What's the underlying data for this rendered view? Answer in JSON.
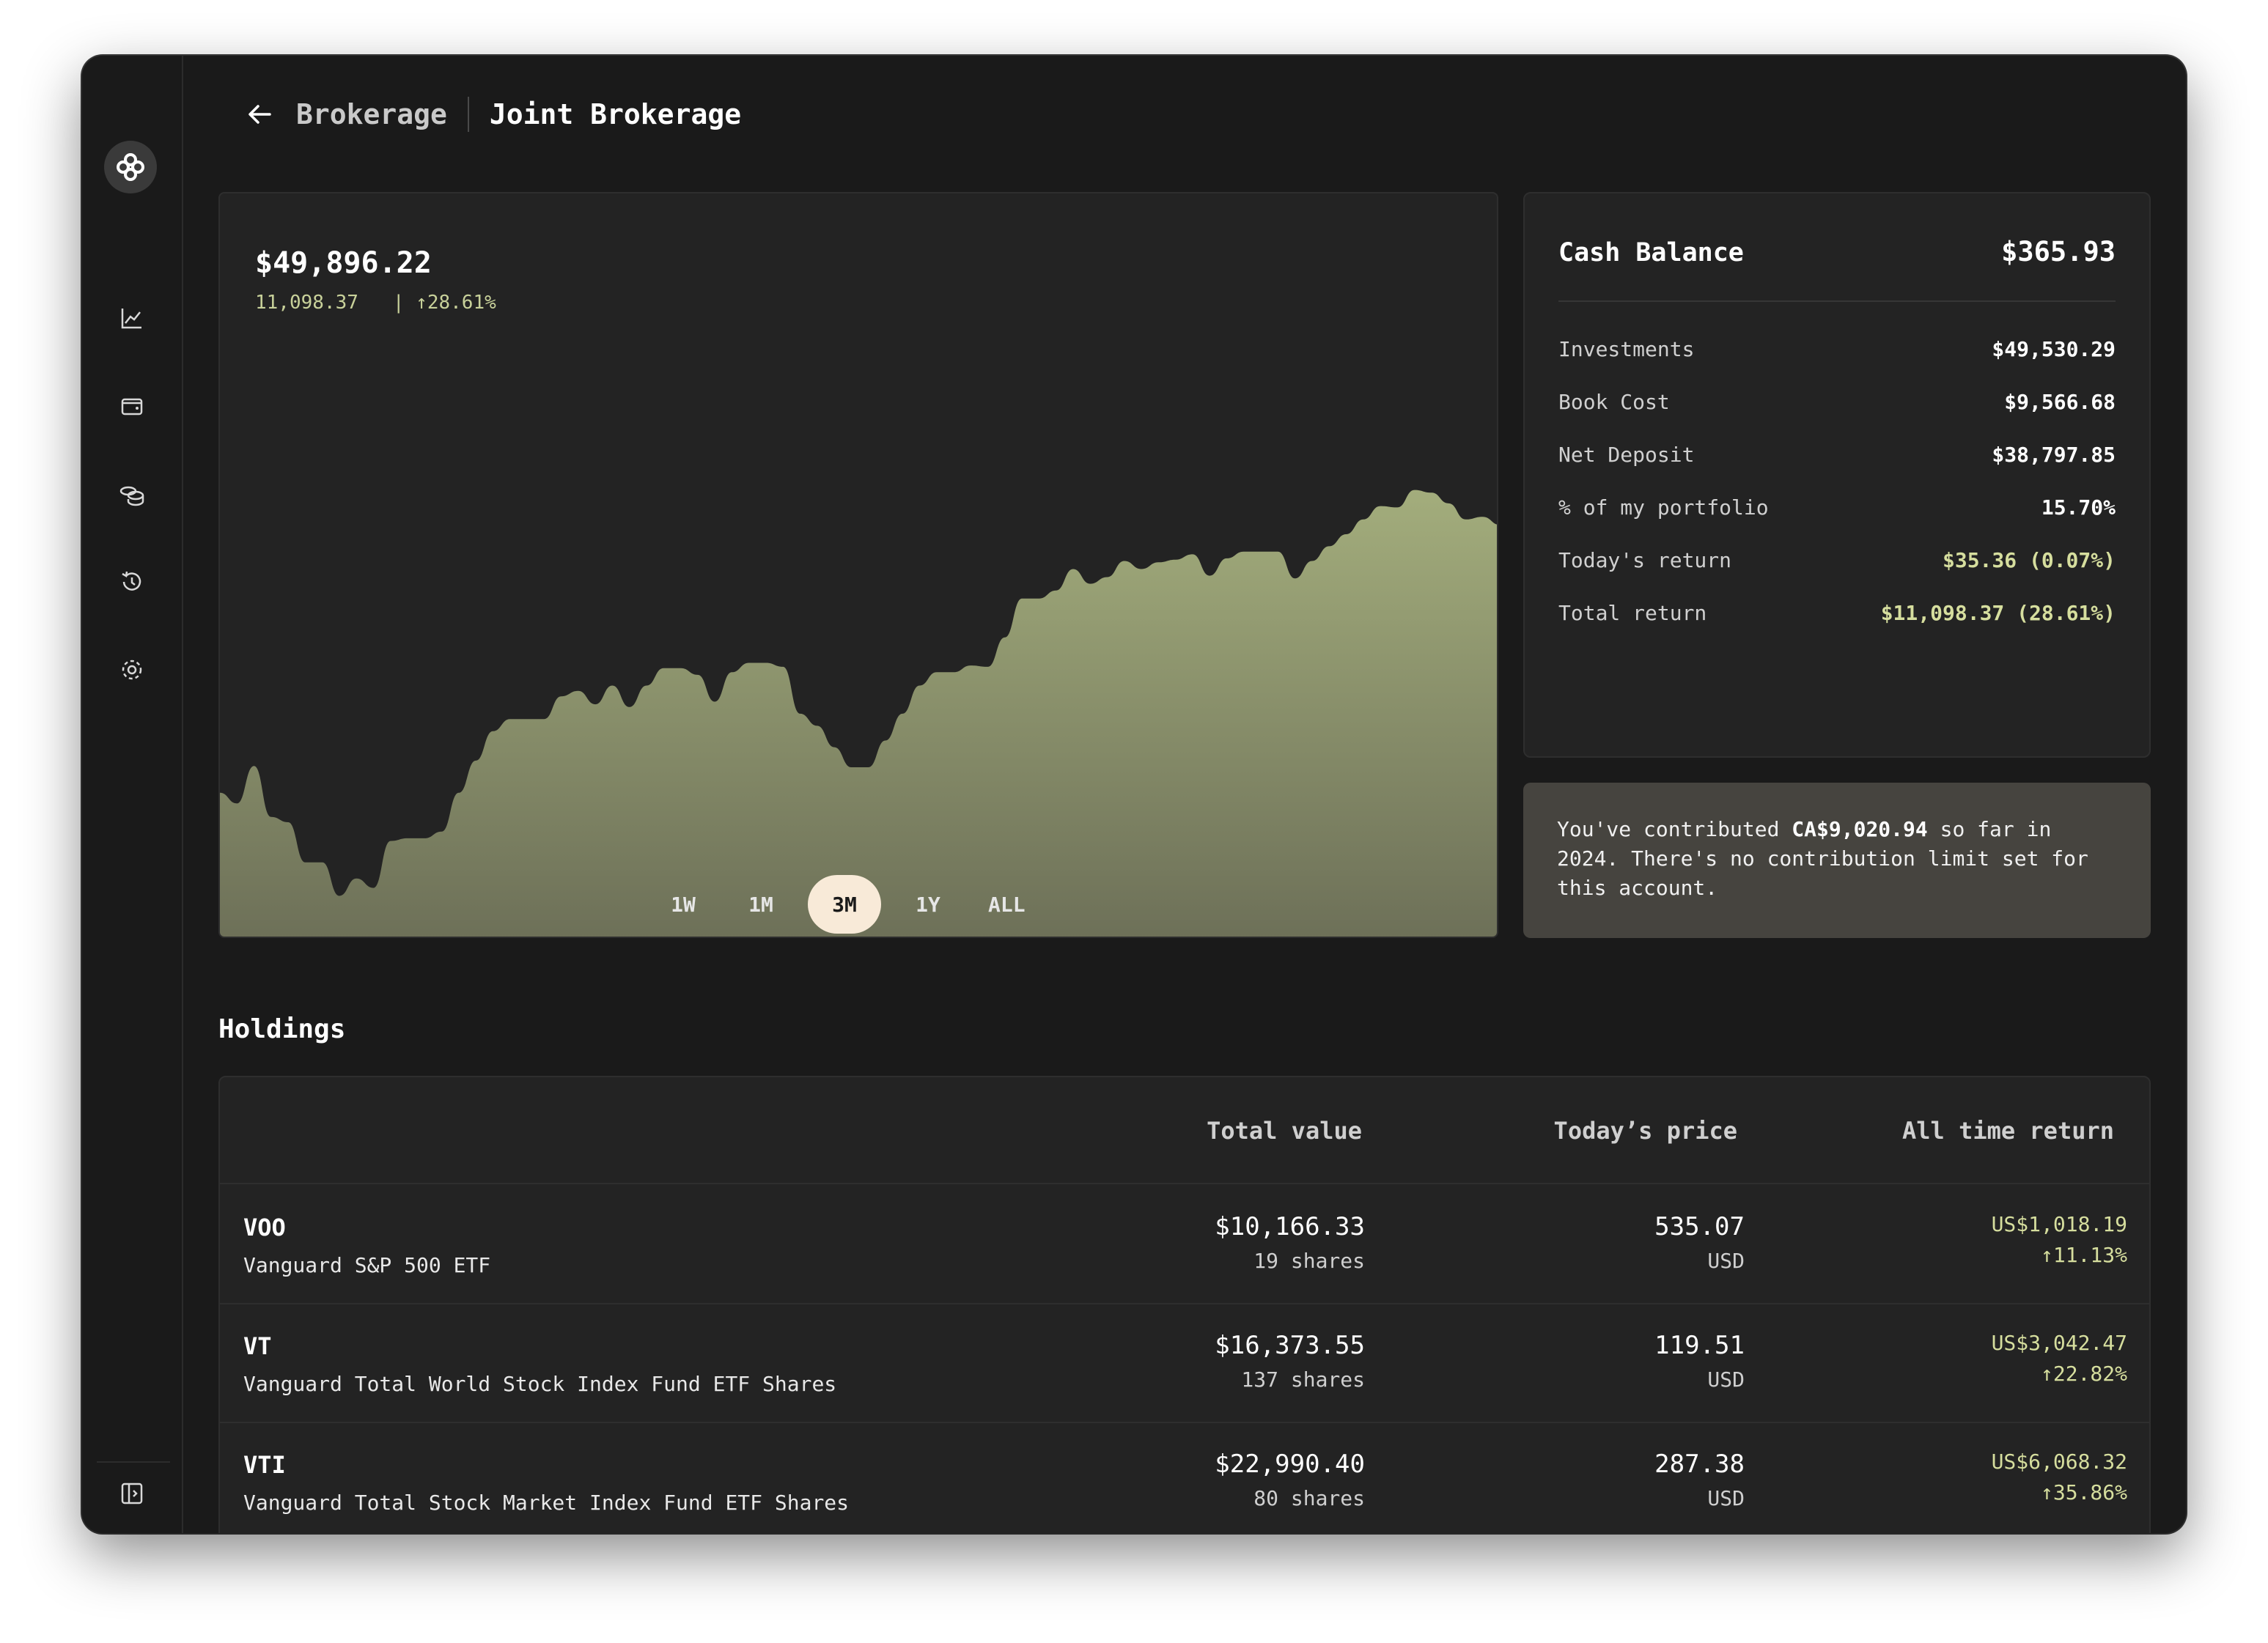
{
  "header": {
    "parent": "Brokerage",
    "title": "Joint Brokerage"
  },
  "chart_header": {
    "value": "$49,896.22",
    "change": "11,098.37",
    "separator": "|",
    "pct": "↑28.61%"
  },
  "range": [
    "1W",
    "1M",
    "3M",
    "1Y",
    "ALL"
  ],
  "range_selected": "3M",
  "chart_data": {
    "type": "area",
    "grid": false,
    "color": "#a3ad7c",
    "values": [
      51.6,
      50.8,
      53.6,
      49.8,
      49.4,
      46.4,
      46.4,
      43.9,
      45.2,
      44.5,
      48.0,
      48.2,
      48.2,
      48.7,
      51.6,
      54.0,
      56.2,
      57.1,
      57.1,
      57.1,
      58.8,
      59.2,
      58.2,
      59.6,
      58.0,
      59.6,
      60.9,
      60.9,
      60.4,
      58.4,
      60.6,
      61.3,
      61.3,
      61.0,
      57.5,
      56.6,
      55.0,
      53.5,
      53.5,
      55.5,
      57.5,
      59.6,
      60.6,
      60.6,
      61.1,
      61.0,
      63.2,
      66.1,
      66.1,
      66.7,
      68.3,
      67.2,
      67.7,
      68.9,
      68.3,
      68.8,
      69.0,
      69.4,
      67.8,
      69.1,
      69.6,
      69.6,
      69.6,
      67.6,
      68.9,
      70.0,
      70.9,
      72.0,
      73.0,
      72.9,
      74.2,
      74.0,
      73.2,
      72.0,
      72.2,
      71.6
    ]
  },
  "sidebar": {
    "icons": [
      "app-logo-icon",
      "chart-icon",
      "wallet-icon",
      "coins-icon",
      "history-icon",
      "gear-icon",
      "sidebar-toggle-icon"
    ]
  },
  "cash": {
    "title": "Cash Balance",
    "amount": "$365.93",
    "rows": [
      {
        "label": "Investments",
        "value": "$49,530.29"
      },
      {
        "label": "Book Cost",
        "value": "$9,566.68"
      },
      {
        "label": "Net Deposit",
        "value": "$38,797.85"
      },
      {
        "label": "% of my portfolio",
        "value": "15.70%"
      },
      {
        "label": "Today's return",
        "value": "$35.36 (0.07%)"
      },
      {
        "label": "Total return",
        "value": "$11,098.37 (28.61%)"
      }
    ]
  },
  "contribution": {
    "before": "You've contributed ",
    "amount": "CA$9,020.94",
    "after": " so far in 2024. There's no contribution limit set for this account."
  },
  "holdings": {
    "title": "Holdings",
    "columns": [
      "Total value",
      "Today’s price",
      "All time return"
    ],
    "rows": [
      {
        "symbol": "VOO",
        "name": "Vanguard S&P 500 ETF",
        "total": "$10,166.33",
        "shares": "19 shares",
        "price": "535.07",
        "currency": "USD",
        "return": "US$1,018.19",
        "pct": "↑11.13%"
      },
      {
        "symbol": "VT",
        "name": "Vanguard Total World Stock Index Fund ETF Shares",
        "total": "$16,373.55",
        "shares": "137 shares",
        "price": "119.51",
        "currency": "USD",
        "return": "US$3,042.47",
        "pct": "↑22.82%"
      },
      {
        "symbol": "VTI",
        "name": "Vanguard Total Stock Market Index Fund ETF Shares",
        "total": "$22,990.40",
        "shares": "80 shares",
        "price": "287.38",
        "currency": "USD",
        "return": "US$6,068.32",
        "pct": "↑35.86%"
      }
    ]
  },
  "colors": {
    "accent": "#a3ad7c",
    "positive": "#d6de9e",
    "selected_range": "#f8ead8"
  }
}
